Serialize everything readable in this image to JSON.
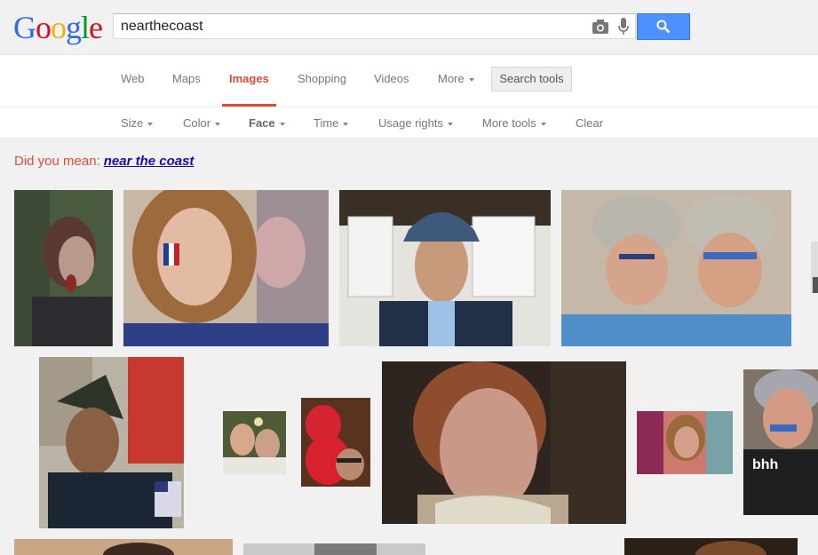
{
  "logo": [
    "G",
    "o",
    "o",
    "g",
    "l",
    "e"
  ],
  "logo_colors": [
    "#3369e8",
    "#d50f25",
    "#eeb211",
    "#3369e8",
    "#009925",
    "#d50f25"
  ],
  "search": {
    "query": "nearthecoast"
  },
  "nav": {
    "tabs": [
      "Web",
      "Maps",
      "Images",
      "Shopping",
      "Videos",
      "More"
    ],
    "search_tools": "Search tools"
  },
  "tools": {
    "items": [
      "Size",
      "Color",
      "Face",
      "Time",
      "Usage rights",
      "More tools",
      "Clear"
    ]
  },
  "spell": {
    "prefix": "Did you mean:",
    "suggestion": "near the coast"
  },
  "colors": {
    "accent_red": "#dd4b39",
    "link_blue": "#1a0dab",
    "button_blue": "#4d90fe"
  }
}
